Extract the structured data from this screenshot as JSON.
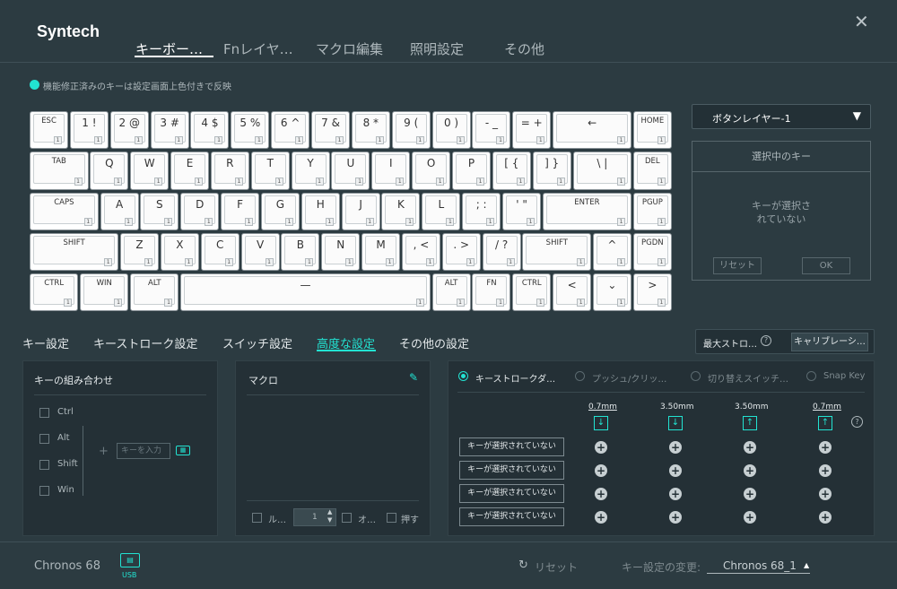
{
  "app": {
    "brand": "Syntech",
    "close_icon": "close-icon"
  },
  "header_tabs": [
    "キーボー…",
    "Fnレイヤ…",
    "マクロ編集",
    "照明設定",
    "その他"
  ],
  "legend": {
    "text": "機能修正済みのキーは設定画面上色付きで反映",
    "color": "#22e3d2"
  },
  "keyboard": {
    "layer_badge": "1",
    "rows": [
      [
        "ESC",
        "1 !",
        "2 @",
        "3 #",
        "4 $",
        "5 %",
        "6 ^",
        "7 &",
        "8 *",
        "9 (",
        "0 )",
        "- _",
        "= +",
        "←",
        "HOME"
      ],
      [
        "TAB",
        "Q",
        "W",
        "E",
        "R",
        "T",
        "Y",
        "U",
        "I",
        "O",
        "P",
        "[ {",
        "] }",
        "\\ |",
        "DEL"
      ],
      [
        "CAPS",
        "A",
        "S",
        "D",
        "F",
        "G",
        "H",
        "J",
        "K",
        "L",
        "; :",
        "' \"",
        "ENTER",
        "PGUP"
      ],
      [
        "SHIFT",
        "Z",
        "X",
        "C",
        "V",
        "B",
        "N",
        "M",
        ", <",
        ". >",
        "/ ?",
        "SHIFT",
        "^",
        "PGDN"
      ],
      [
        "CTRL",
        "WIN",
        "ALT",
        "—",
        "ALT",
        "FN",
        "CTRL",
        "<",
        "⌄",
        ">"
      ]
    ]
  },
  "right_panel": {
    "layer_select": "ボタンレイヤー-1",
    "selected_title": "選択中のキー",
    "selected_none": "キーが選択さ\nれていない",
    "reset": "リセット",
    "ok": "OK"
  },
  "sub_tabs": [
    "キー設定",
    "キーストローク設定",
    "スイッチ設定",
    "高度な設定",
    "その他の設定"
  ],
  "top_right": {
    "max_stroke": "最大ストロ…",
    "help_icon": "help-icon",
    "calibration": "キャリブレーシ…"
  },
  "combo_panel": {
    "title": "キーの組み合わせ",
    "modifiers": [
      "Ctrl",
      "Alt",
      "Shift",
      "Win"
    ],
    "plus": "+",
    "key_input_placeholder": "キーを入力"
  },
  "macro_panel": {
    "title": "マクロ",
    "loop_label": "ル…",
    "count": "1",
    "other_label": "オ…",
    "press_label": "押す"
  },
  "advanced_panel": {
    "modes": [
      "キーストロークダ…",
      "プッシュ/クリッ…",
      "切り替えスイッチ…",
      "Snap Key"
    ],
    "columns": [
      "0.7mm",
      "3.50mm",
      "3.50mm",
      "0.7mm"
    ],
    "row_buttons": [
      "キーが選択されていない",
      "キーが選択されていない",
      "キーが選択されていない",
      "キーが選択されていない"
    ]
  },
  "footer": {
    "device": "Chronos 68",
    "usb_label": "USB",
    "reset": "リセット",
    "change_label": "キー設定の変更:",
    "profile": "Chronos 68_1"
  }
}
